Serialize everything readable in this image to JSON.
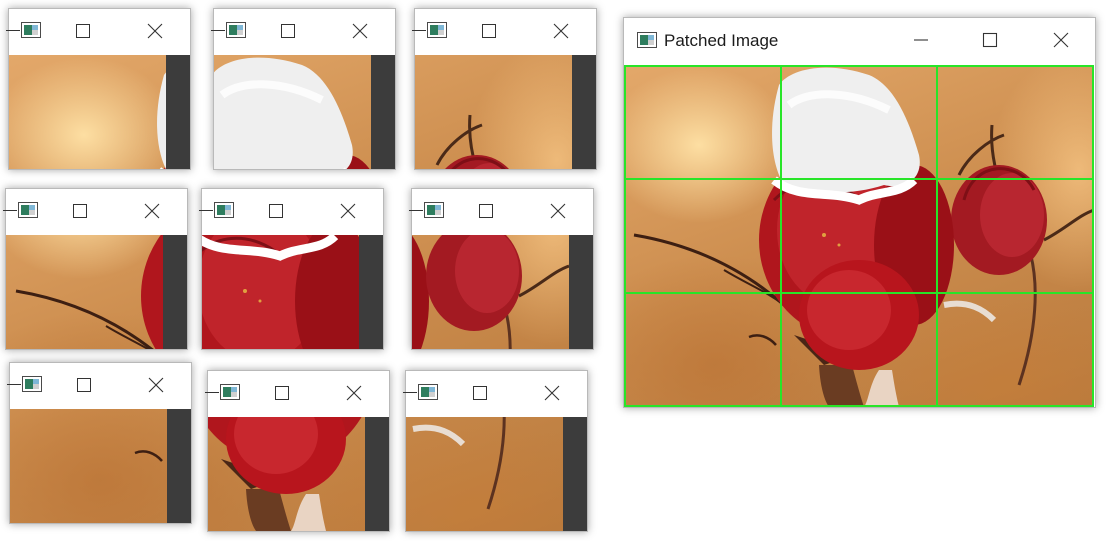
{
  "main_window": {
    "title": "Patched Image",
    "app_icon": "image-app-icon",
    "buttons": [
      "minimize-icon",
      "maximize-icon",
      "close-icon"
    ],
    "grid": {
      "rows": 3,
      "cols": 3,
      "line_color": "#28e528"
    }
  },
  "patch_windows": [
    {
      "row": 1,
      "col": 1
    },
    {
      "row": 1,
      "col": 2
    },
    {
      "row": 1,
      "col": 3
    },
    {
      "row": 2,
      "col": 1
    },
    {
      "row": 2,
      "col": 2
    },
    {
      "row": 2,
      "col": 3
    },
    {
      "row": 3,
      "col": 1
    },
    {
      "row": 3,
      "col": 2
    },
    {
      "row": 3,
      "col": 3
    }
  ],
  "colors": {
    "titlebar": "#ffffff",
    "patch_strip": "#3c3c3c",
    "background": "#ffffff",
    "rose_red": "#a8141c",
    "snow": "#f2f2f2"
  }
}
